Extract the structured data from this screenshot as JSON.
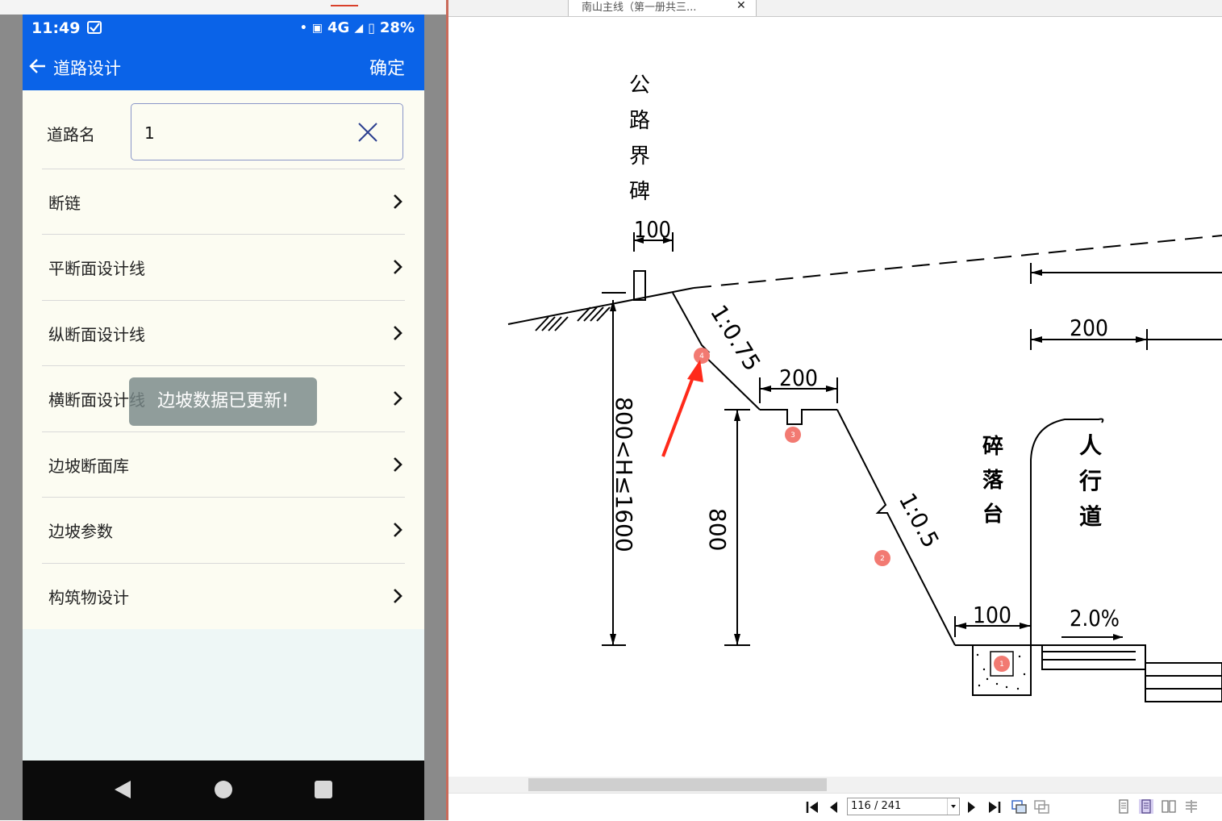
{
  "phone": {
    "status": {
      "time": "11:49",
      "network": "4G",
      "battery": "28%"
    },
    "app_bar": {
      "title": "道路设计",
      "confirm_label": "确定"
    },
    "road_name": {
      "label": "道路名",
      "value": "1"
    },
    "menu": [
      {
        "label": "断链"
      },
      {
        "label": "平断面设计线"
      },
      {
        "label": "纵断面设计线"
      },
      {
        "label": "横断面设计线"
      },
      {
        "label": "边坡断面库"
      },
      {
        "label": "边坡参数"
      },
      {
        "label": "构筑物设计"
      }
    ],
    "toast": "边坡数据已更新!"
  },
  "viewer": {
    "tab_title": "南山主线（第一册共三...",
    "page_indicator": "116 / 241",
    "drawing": {
      "labels": {
        "boundary_marker": [
          "公",
          "路",
          "界",
          "碑"
        ],
        "dim_marker_width": "100",
        "slope_upper": "1:0.75",
        "dim_platform": "200",
        "dim_right_top": "200",
        "height_range": "800<H≤1600",
        "height_fixed": "800",
        "slope_lower": "1:0.5",
        "rockfall_platform": [
          "碎",
          "落",
          "台"
        ],
        "sidewalk": [
          "人",
          "行",
          "道"
        ],
        "dim_bottom": "100",
        "grade": "2.0%"
      },
      "markers": [
        "1",
        "2",
        "3",
        "4"
      ]
    }
  },
  "colors": {
    "accent": "#0a63e8",
    "arrow": "#ff2a1a",
    "marker": "#f27a72"
  }
}
